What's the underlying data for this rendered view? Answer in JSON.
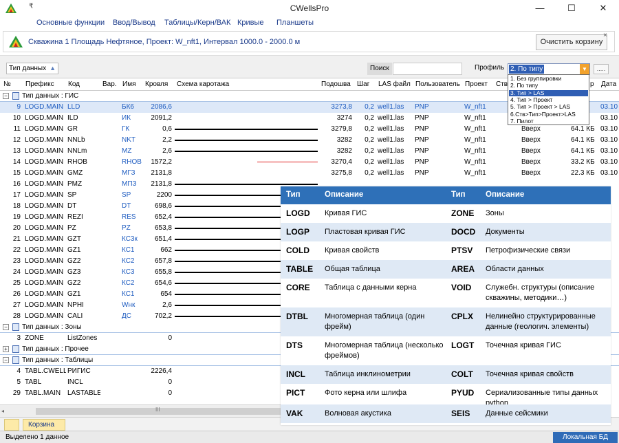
{
  "window": {
    "title": "CWellsPro",
    "quick_access": "₹",
    "min": "—",
    "max": "☐",
    "close": "✕"
  },
  "menu": [
    "Основные функции",
    "Ввод/Вывод",
    "Таблицы/Керн/ВАК",
    "Кривые",
    "Планшеты"
  ],
  "info": {
    "text": "Скважина 1  Площадь Нефтяное, Проект: W_nft1,   Интервал 1000.0 - 2000.0 м",
    "clear_label": "Очистить корзину",
    "close": "×"
  },
  "toolbar": {
    "data_type": "Тип данных",
    "search_label": "Поиск",
    "search_value": "",
    "profile_label": "Профиль",
    "profile_value": "2. По типу",
    "ellipsis": "....."
  },
  "profile_options": [
    "1. Без группировки",
    "2. По типу",
    "3. Тип > LAS",
    "4. Тип > Проект",
    "5. Тип > Проект > LAS",
    "6.Ств>Тип>Проект>LAS",
    "7. Пилот"
  ],
  "profile_active_index": 2,
  "columns": [
    "№",
    "Префикс",
    "Код",
    "Вар.",
    "Имя",
    "Кровля",
    "Схема каротажа",
    "Подошва",
    "Шаг",
    "LAS файл",
    "Пользователь",
    "Проект",
    "Ство",
    "",
    "р",
    "Дата"
  ],
  "groups": {
    "gis": "Тип данных : ГИС",
    "zones": "Тип данных : Зоны",
    "other": "Тип данных : Прочее",
    "tables": "Тип данных : Таблицы",
    "pm_open": "−",
    "pm_closed": "+"
  },
  "rows": [
    {
      "n": "9",
      "prefix": "LOGD.MAIN",
      "code": "LLD",
      "name": "БК6",
      "top": "2086,6",
      "bottom": "3273,8",
      "step": "0,2",
      "las": "well1.las",
      "user": "PNP",
      "project": "W_nft1",
      "ws": "",
      "size": "Б",
      "date": "03.10",
      "sel": true
    },
    {
      "n": "10",
      "prefix": "LOGD.MAIN",
      "code": "ILD",
      "name": "ИК",
      "top": "2091,2",
      "bottom": "3274",
      "step": "0,2",
      "las": "well1.las",
      "user": "PNP",
      "project": "W_nft1",
      "ws": "",
      "size": "Б",
      "date": "03.10"
    },
    {
      "n": "11",
      "prefix": "LOGD.MAIN",
      "code": "GR",
      "name": "ГК",
      "top": "0,6",
      "bottom": "3279,8",
      "step": "0,2",
      "las": "well1.las",
      "user": "PNP",
      "project": "W_nft1",
      "ws": "Вверх",
      "size": "64.1 КБ",
      "date": "03.10"
    },
    {
      "n": "12",
      "prefix": "LOGD.MAIN",
      "code": "NNLb",
      "name": "NKT",
      "top": "2,2",
      "bottom": "3282",
      "step": "0,2",
      "las": "well1.las",
      "user": "PNP",
      "project": "W_nft1",
      "ws": "Вверх",
      "size": "64.1 КБ",
      "date": "03.10"
    },
    {
      "n": "13",
      "prefix": "LOGD.MAIN",
      "code": "NNLm",
      "name": "MZ",
      "top": "2,6",
      "bottom": "3282",
      "step": "0,2",
      "las": "well1.las",
      "user": "PNP",
      "project": "W_nft1",
      "ws": "Вверх",
      "size": "64.1 КБ",
      "date": "03.10"
    },
    {
      "n": "14",
      "prefix": "LOGD.MAIN",
      "code": "RHOB",
      "name": "RHOB",
      "top": "1572,2",
      "bottom": "3270,4",
      "step": "0,2",
      "las": "well1.las",
      "user": "PNP",
      "project": "W_nft1",
      "ws": "Вверх",
      "size": "33.2 КБ",
      "date": "03.10"
    },
    {
      "n": "15",
      "prefix": "LOGD.MAIN",
      "code": "GMZ",
      "name": "МГЗ",
      "top": "2131,8",
      "bottom": "3275,8",
      "step": "0,2",
      "las": "well1.las",
      "user": "PNP",
      "project": "W_nft1",
      "ws": "Вверх",
      "size": "22.3 КБ",
      "date": "03.10"
    },
    {
      "n": "16",
      "prefix": "LOGD.MAIN",
      "code": "PMZ",
      "name": "МПЗ",
      "top": "2131,8",
      "bottom": "",
      "step": "",
      "las": "",
      "user": "",
      "project": "",
      "ws": "",
      "size": "",
      "date": ""
    },
    {
      "n": "17",
      "prefix": "LOGD.MAIN",
      "code": "SP",
      "name": "SP",
      "top": "2200"
    },
    {
      "n": "18",
      "prefix": "LOGD.MAIN",
      "code": "DT",
      "name": "DT",
      "top": "698,6"
    },
    {
      "n": "19",
      "prefix": "LOGD.MAIN",
      "code": "REZI",
      "name": "RES",
      "top": "652,4"
    },
    {
      "n": "20",
      "prefix": "LOGD.MAIN",
      "code": "PZ",
      "name": "PZ",
      "top": "653,8"
    },
    {
      "n": "21",
      "prefix": "LOGD.MAIN",
      "code": "GZT",
      "name": "КС3к",
      "top": "651,4"
    },
    {
      "n": "22",
      "prefix": "LOGD.MAIN",
      "code": "GZ1",
      "name": "КС1",
      "top": "662"
    },
    {
      "n": "23",
      "prefix": "LOGD.MAIN",
      "code": "GZ2",
      "name": "КС2",
      "top": "657,8"
    },
    {
      "n": "24",
      "prefix": "LOGD.MAIN",
      "code": "GZ3",
      "name": "КС3",
      "top": "655,8"
    },
    {
      "n": "25",
      "prefix": "LOGD.MAIN",
      "code": "GZ2",
      "name": "КС2",
      "top": "654,6"
    },
    {
      "n": "26",
      "prefix": "LOGD.MAIN",
      "code": "GZ1",
      "name": "КС1",
      "top": "654"
    },
    {
      "n": "27",
      "prefix": "LOGD.MAIN",
      "code": "NPHI",
      "name": "Wнк",
      "top": "2,6"
    },
    {
      "n": "28",
      "prefix": "LOGD.MAIN",
      "code": "CALI",
      "name": "ДС",
      "top": "702,2"
    }
  ],
  "zone_row": {
    "n": "3",
    "prefix": "ZONE",
    "code": "ListZones",
    "top": "0"
  },
  "table_rows": [
    {
      "n": "4",
      "prefix": "TABL.CWELL",
      "code": "РИГИС",
      "top": "2226,4"
    },
    {
      "n": "5",
      "prefix": "TABL",
      "code": "INCL",
      "top": "0"
    },
    {
      "n": "29",
      "prefix": "TABL.MAIN",
      "code": "LASTABLE",
      "top": "0"
    }
  ],
  "overlay": {
    "h_type": "Тип",
    "h_desc": "Описание",
    "rows": [
      {
        "t1": "LOGD",
        "d1": "Кривая ГИС",
        "t2": "ZONE",
        "d2": "Зоны"
      },
      {
        "t1": "LOGP",
        "d1": "Пластовая кривая ГИС",
        "t2": "DOCD",
        "d2": "Документы"
      },
      {
        "t1": "COLD",
        "d1": "Кривая свойств",
        "t2": "PTSV",
        "d2": "Петрофизические связи"
      },
      {
        "t1": "TABLE",
        "d1": "Общая таблица",
        "t2": "AREA",
        "d2": "Области данных"
      },
      {
        "t1": "CORE",
        "d1": "Таблица с данными керна",
        "t2": "VOID",
        "d2": "Служебн. структуры (описание скважины, методики…)"
      },
      {
        "t1": "DTBL",
        "d1": "Многомерная таблица (один фрейм)",
        "t2": "CPLX",
        "d2": "Нелинейно структурированные данные (геологич. элементы)"
      },
      {
        "t1": "DTS",
        "d1": "Многомерная таблица (несколько фреймов)",
        "t2": "LOGT",
        "d2": "Точечная кривая ГИС"
      },
      {
        "t1": "INCL",
        "d1": "Таблица инклинометрии",
        "t2": "COLT",
        "d2": "Точечная кривая свойств"
      },
      {
        "t1": "PICT",
        "d1": "Фото керна или шлифа",
        "t2": "PYUD",
        "d2": "Сериализованные типы данных python"
      },
      {
        "t1": "VAK",
        "d1": "Волновая акустика",
        "t2": "SEIS",
        "d2": "Данные сейсмики"
      }
    ]
  },
  "hscroll": {
    "left": "◂",
    "mid": "III"
  },
  "basket": {
    "label": "Корзина"
  },
  "status": {
    "left": "Выделено 1 данное",
    "right": "Локальная БД"
  },
  "colors": {
    "accent": "#2e70b8",
    "link": "#1e5cc0",
    "selection": "#2f5eb4",
    "alt_row": "#dfe9f5",
    "red_curve": "#e02020"
  }
}
